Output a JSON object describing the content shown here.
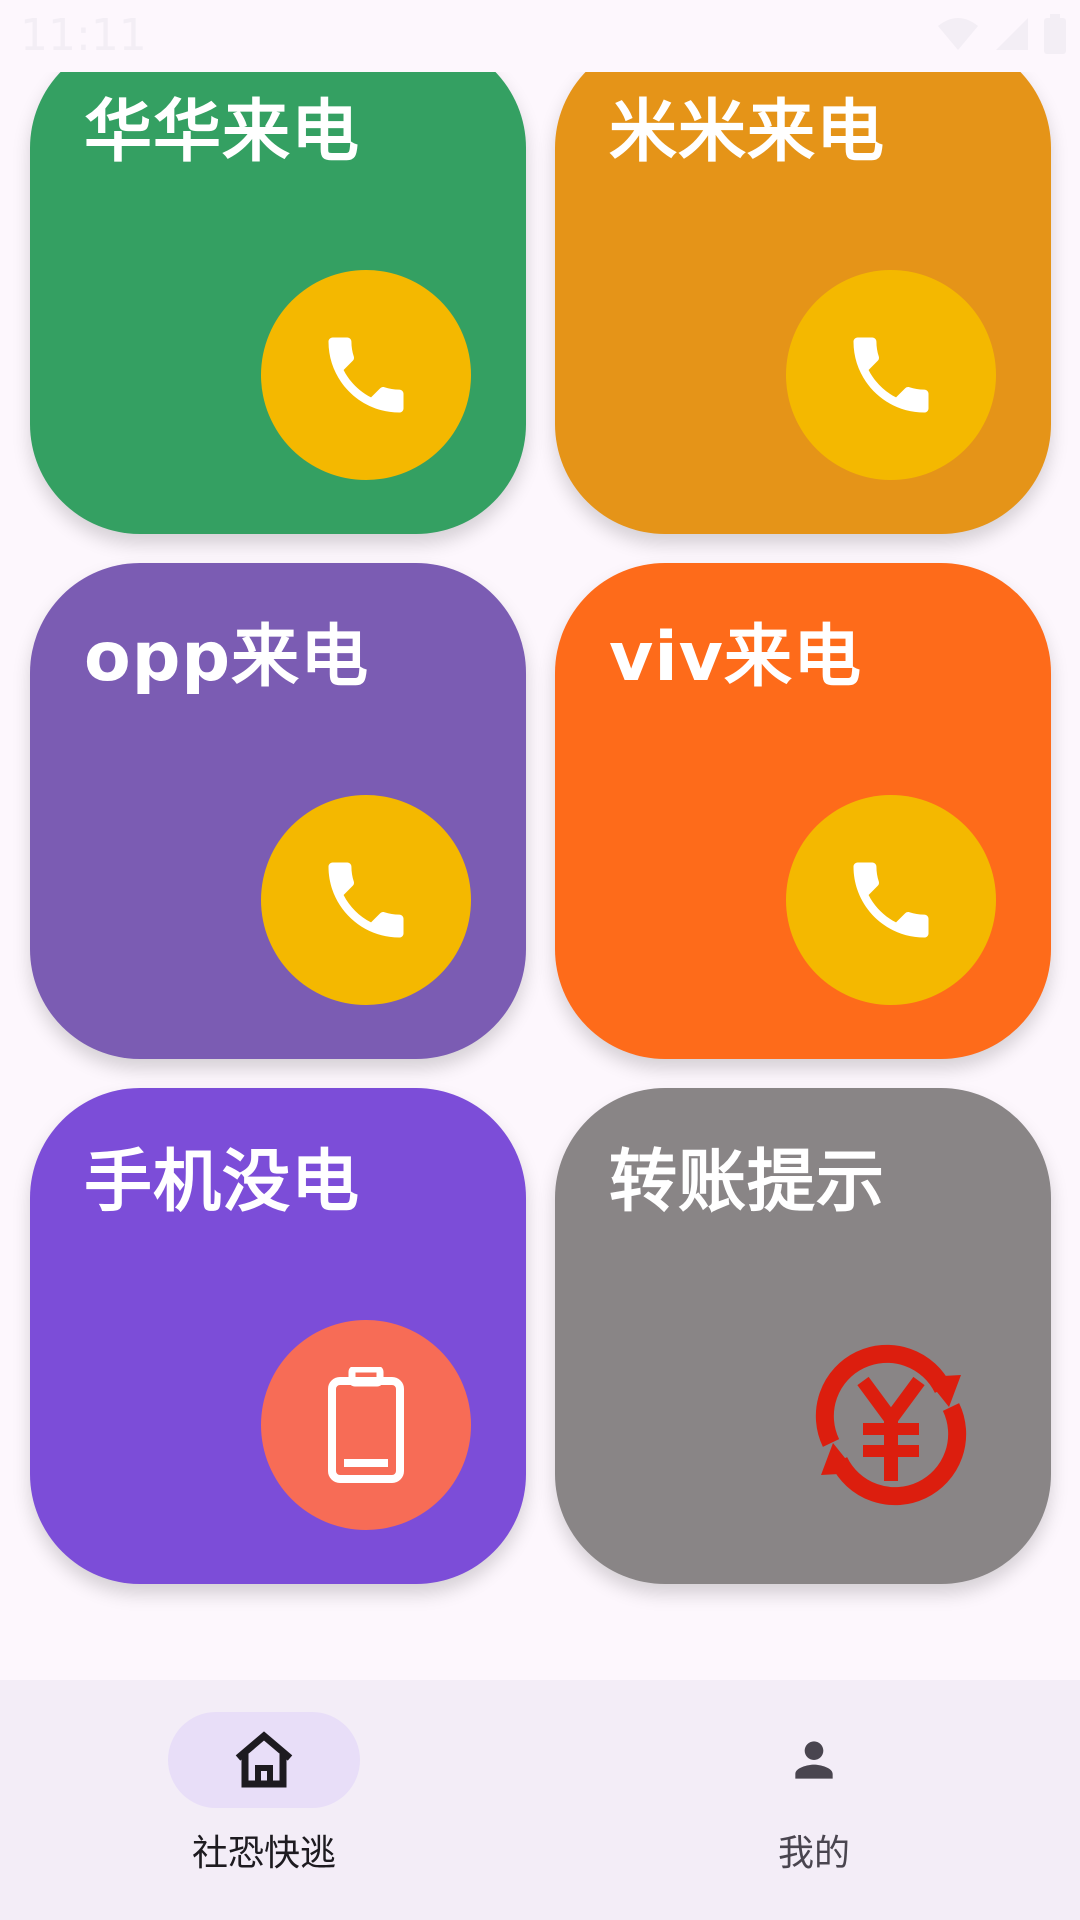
{
  "status_bar": {
    "time": "11:11"
  },
  "cards": [
    {
      "title": "华华来电",
      "bg": "#34a062",
      "circle_bg": "#f4b800",
      "icon": "phone-icon"
    },
    {
      "title": "米米来电",
      "bg": "#e59418",
      "circle_bg": "#f4b800",
      "icon": "phone-icon"
    },
    {
      "title": "opp来电",
      "bg": "#7b5cb3",
      "circle_bg": "#f4b800",
      "icon": "phone-icon"
    },
    {
      "title": "viv来电",
      "bg": "#fe6b1a",
      "circle_bg": "#f4b800",
      "icon": "phone-icon"
    },
    {
      "title": "手机没电",
      "bg": "#7c4dd8",
      "circle_bg": "#f76c56",
      "icon": "battery-icon"
    },
    {
      "title": "转账提示",
      "bg": "#898586",
      "circle_bg": "transparent",
      "icon": "yuan-transfer-icon",
      "icon_color": "#dc1e0e"
    }
  ],
  "nav": {
    "items": [
      {
        "label": "社恐快逃",
        "icon": "home-icon",
        "selected": true,
        "pill_bg": "#e8def8"
      },
      {
        "label": "我的",
        "icon": "person-icon",
        "selected": false
      }
    ]
  }
}
